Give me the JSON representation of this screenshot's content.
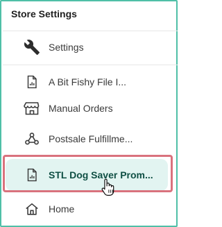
{
  "header": {
    "title": "Store Settings"
  },
  "nav": {
    "items": [
      {
        "label": "Settings",
        "icon": "wrench-icon"
      },
      {
        "label": "A Bit Fishy File I...",
        "icon": "report-file-icon"
      },
      {
        "label": "Manual Orders",
        "icon": "storefront-icon"
      },
      {
        "label": "Postsale Fulfillme...",
        "icon": "webhook-icon"
      },
      {
        "label": "STL Dog Saver Prom...",
        "icon": "report-file-icon",
        "active": true
      },
      {
        "label": "Home",
        "icon": "home-icon"
      }
    ]
  },
  "colors": {
    "border": "#4fbfa7",
    "active_bg": "#e2f4f1",
    "active_text": "#0f4f44",
    "highlight": "#d9727d"
  }
}
